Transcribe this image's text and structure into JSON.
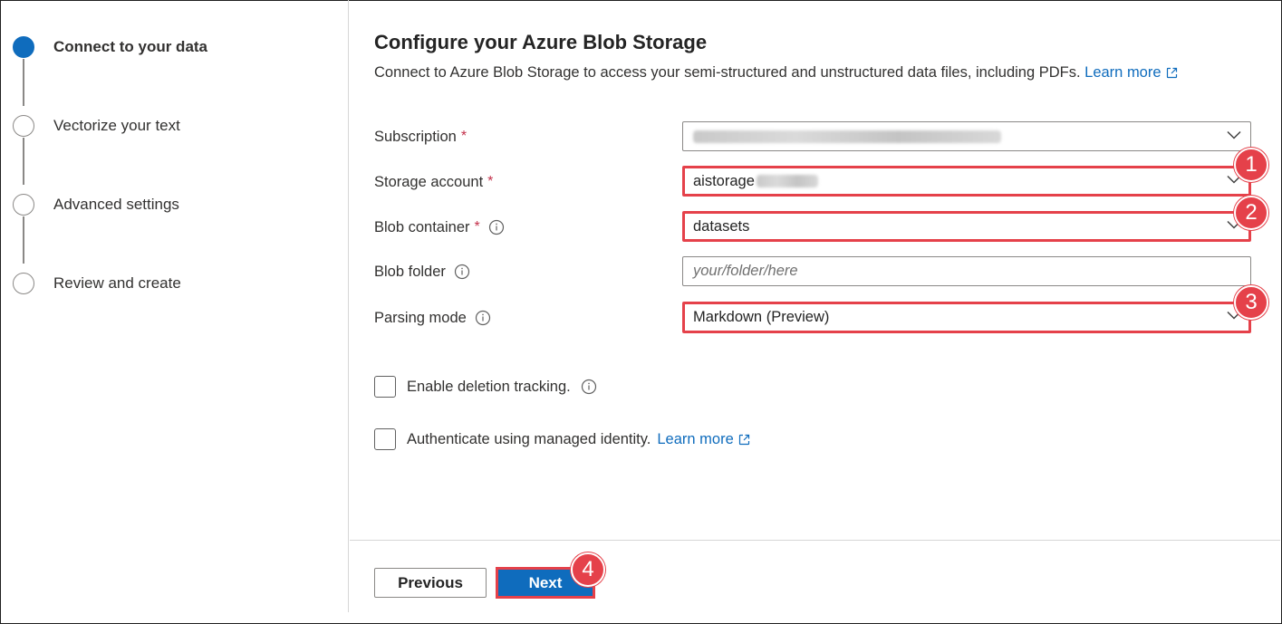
{
  "steps": [
    {
      "label": "Connect to your data",
      "state": "active"
    },
    {
      "label": "Vectorize your text",
      "state": "pending"
    },
    {
      "label": "Advanced settings",
      "state": "pending"
    },
    {
      "label": "Review and create",
      "state": "pending"
    }
  ],
  "main": {
    "title": "Configure your Azure Blob Storage",
    "subtitle": "Connect to Azure Blob Storage to access your semi-structured and unstructured data files, including PDFs.",
    "learn_more": "Learn more"
  },
  "form": {
    "subscription": {
      "label": "Subscription",
      "required_mark": "*",
      "value_redacted": true
    },
    "storage_account": {
      "label": "Storage account",
      "required_mark": "*",
      "value": "aistorage"
    },
    "blob_container": {
      "label": "Blob container",
      "required_mark": "*",
      "value": "datasets"
    },
    "blob_folder": {
      "label": "Blob folder",
      "placeholder": "your/folder/here"
    },
    "parsing_mode": {
      "label": "Parsing mode",
      "value": "Markdown (Preview)"
    }
  },
  "checkboxes": {
    "deletion_tracking": {
      "label": "Enable deletion tracking.",
      "checked": false
    },
    "managed_identity": {
      "label": "Authenticate using managed identity.",
      "link": "Learn more",
      "checked": false
    }
  },
  "buttons": {
    "previous": "Previous",
    "next": "Next"
  },
  "callouts": [
    "1",
    "2",
    "3",
    "4"
  ],
  "colors": {
    "accent": "#0f6cbd",
    "callout": "#e5414a",
    "required": "#c4314b"
  }
}
